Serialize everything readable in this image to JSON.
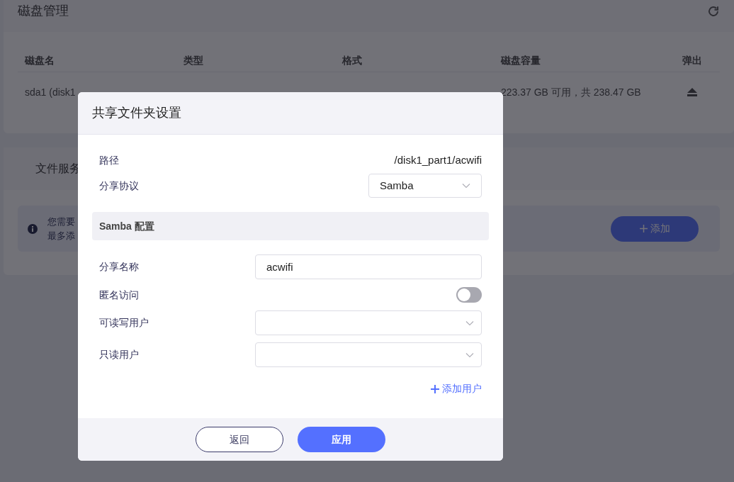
{
  "disk_panel": {
    "title": "磁盘管理",
    "columns": [
      "磁盘名",
      "类型",
      "格式",
      "磁盘容量",
      "弹出"
    ],
    "rows": [
      {
        "name": "sda1 (disk1",
        "type": "",
        "format": "",
        "capacity": "223.37 GB 可用，共 238.47 GB"
      }
    ]
  },
  "file_service": {
    "tab_label": "文件服务",
    "notice": [
      "您需要",
      "最多添"
    ],
    "add_button": "添加"
  },
  "dialog": {
    "title": "共享文件夹设置",
    "path": {
      "label": "路径",
      "value": "/disk1_part1/acwifi"
    },
    "protocol": {
      "label": "分享协议",
      "value": "Samba"
    },
    "section_title": "Samba 配置",
    "share_name": {
      "label": "分享名称",
      "value": "acwifi"
    },
    "anonymous_access": {
      "label": "匿名访问",
      "on": false
    },
    "user_selects": [
      {
        "label": "可读写用户"
      },
      {
        "label": "只读用户"
      }
    ],
    "add_user": "添加用户",
    "buttons": [
      {
        "label": "返回",
        "kind": "secondary"
      },
      {
        "label": "应用",
        "kind": "primary"
      }
    ]
  }
}
